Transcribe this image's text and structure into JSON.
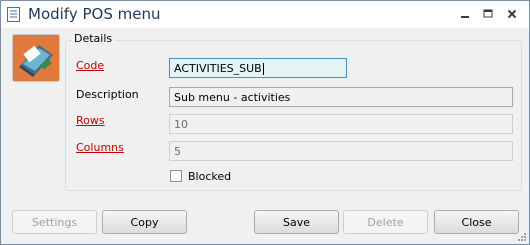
{
  "window": {
    "title": "Modify POS menu"
  },
  "group": {
    "title": "Details"
  },
  "form": {
    "code": {
      "label": "Code",
      "value": "ACTIVITIES_SUB"
    },
    "description": {
      "label": "Description",
      "value": "Sub menu - activities"
    },
    "rows": {
      "label": "Rows",
      "value": "10"
    },
    "columns": {
      "label": "Columns",
      "value": "5"
    },
    "blocked": {
      "label": "Blocked",
      "checked": false
    }
  },
  "buttons": {
    "settings": "Settings",
    "copy": "Copy",
    "save": "Save",
    "delete": "Delete",
    "close": "Close"
  },
  "colors": {
    "title_text": "#1e395b",
    "required_label": "#c00000",
    "active_field_bg": "#e4f5f7",
    "active_field_border": "#3c9bb0"
  }
}
